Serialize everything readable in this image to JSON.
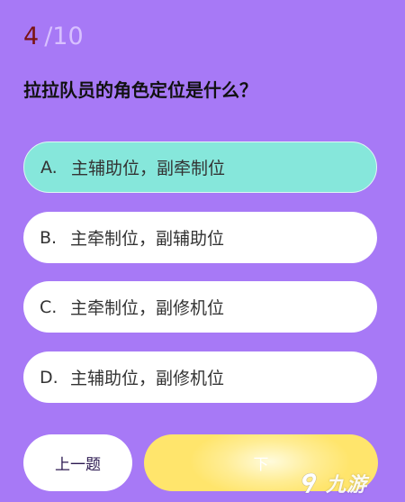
{
  "quiz": {
    "progress": {
      "current": "4",
      "total": "/10"
    },
    "question": "拉拉队员的角色定位是什么？",
    "options": [
      {
        "letter": "A.",
        "text": "主辅助位，副牵制位",
        "selected": true
      },
      {
        "letter": "B.",
        "text": "主牵制位，副辅助位",
        "selected": false
      },
      {
        "letter": "C.",
        "text": "主牵制位，副修机位",
        "selected": false
      },
      {
        "letter": "D.",
        "text": "主辅助位，副修机位",
        "selected": false
      }
    ],
    "prev_label": "上一题",
    "next_label": "下"
  },
  "watermark": {
    "text": "九游",
    "icon": "nine-game-logo-icon"
  },
  "colors": {
    "background": "#a779f6",
    "selected_option": "#86e7db",
    "option": "#ffffff",
    "next_button": "#ffe56c",
    "current_number": "#7a1313",
    "total_number": "#d8c0ff"
  }
}
